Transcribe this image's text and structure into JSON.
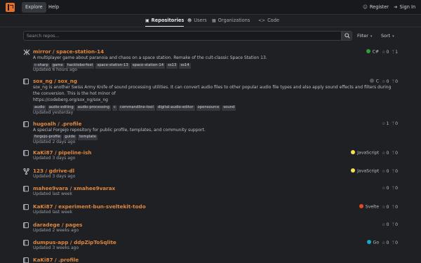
{
  "nav": {
    "explore": "Explore",
    "help": "Help",
    "register": "Register",
    "signin": "Sign In"
  },
  "tabs": [
    "Repositories",
    "Users",
    "Organizations",
    "Code"
  ],
  "search": {
    "placeholder": "Search repos...",
    "filter": "Filter",
    "sort": "Sort"
  },
  "colors": {
    "accent": "#e0873f",
    "csharp": "#2e9e3b",
    "c": "#555555",
    "javascript": "#f1e05a",
    "svelte": "#e54b1f",
    "go": "#19a8c8"
  },
  "repos": [
    {
      "owner": "mirror",
      "name": "space-station-14",
      "icon": "mirror-icon",
      "desc": "A multiplayer game about paranoia and chaos on a space station. Remake of the cult-classic Space Station 13.",
      "topics": [
        "c-sharp",
        "game",
        "hacktoberfest",
        "space-station-13",
        "space-station-14",
        "ss13",
        "ss14"
      ],
      "updated": "Updated 6 hours ago",
      "lang": "C#",
      "lang_color": "#2e9e3b",
      "stars": "0",
      "forks": "1"
    },
    {
      "owner": "sox_ng",
      "name": "sox_ng",
      "icon": "repo-icon",
      "desc": "sox_ng is another Swiss Army Knife of sound processing utilities. It can convert audio files to other popular audio file types and also apply sound effects and filters during the conversion. This is the hot minor of",
      "link": "https://codeberg.org/sox_ng/sox_ng",
      "topics": [
        "audio",
        "audio-editing",
        "audio-processing",
        "c",
        "commandline-tool",
        "digital-audio-editor",
        "opensource",
        "sound"
      ],
      "updated": "Updated yesterday",
      "lang": "C",
      "lang_color": "#555555",
      "stars": "0",
      "forks": "0"
    },
    {
      "owner": "hugoalh",
      "name": ".profile",
      "icon": "repo-icon",
      "desc": "A special Forgejo repository for public profile, templates, and community support.",
      "topics": [
        "forgejo-profile",
        "guide",
        "template"
      ],
      "updated": "Updated 2 days ago",
      "lang": "",
      "lang_color": "",
      "stars": "1",
      "forks": "0"
    },
    {
      "owner": "KaKi87",
      "name": "pipeline-ish",
      "icon": "repo-icon",
      "desc": "",
      "topics": [],
      "updated": "Updated 3 days ago",
      "lang": "JavaScript",
      "lang_color": "#f1e05a",
      "stars": "0",
      "forks": "0"
    },
    {
      "owner": "123",
      "name": "gdrive-dl",
      "icon": "fork-icon",
      "desc": "",
      "topics": [],
      "updated": "Updated 3 days ago",
      "lang": "JavaScript",
      "lang_color": "#f1e05a",
      "stars": "0",
      "forks": "0"
    },
    {
      "owner": "mahee9vara",
      "name": "xmahee9varax",
      "icon": "repo-icon",
      "desc": "",
      "topics": [],
      "updated": "Updated last week",
      "lang": "",
      "lang_color": "",
      "stars": "0",
      "forks": "0"
    },
    {
      "owner": "KaKi87",
      "name": "experiment-bun-sveltekit-todo",
      "icon": "repo-icon",
      "desc": "",
      "topics": [],
      "updated": "Updated last week",
      "lang": "Svelte",
      "lang_color": "#e54b1f",
      "stars": "0",
      "forks": "0"
    },
    {
      "owner": "daradege",
      "name": "pages",
      "icon": "repo-icon",
      "desc": "",
      "topics": [],
      "updated": "Updated 2 weeks ago",
      "lang": "",
      "lang_color": "",
      "stars": "0",
      "forks": "0"
    },
    {
      "owner": "dumpus-app",
      "name": "ddpZipToSqlite",
      "icon": "repo-icon",
      "desc": "",
      "topics": [],
      "updated": "Updated 3 weeks ago",
      "lang": "Go",
      "lang_color": "#19a8c8",
      "stars": "0",
      "forks": "0"
    },
    {
      "owner": "KaKi87",
      "name": ".profile",
      "icon": "repo-icon",
      "desc": "",
      "topics": [],
      "updated": "",
      "lang": "",
      "lang_color": "",
      "stars": "",
      "forks": ""
    }
  ]
}
